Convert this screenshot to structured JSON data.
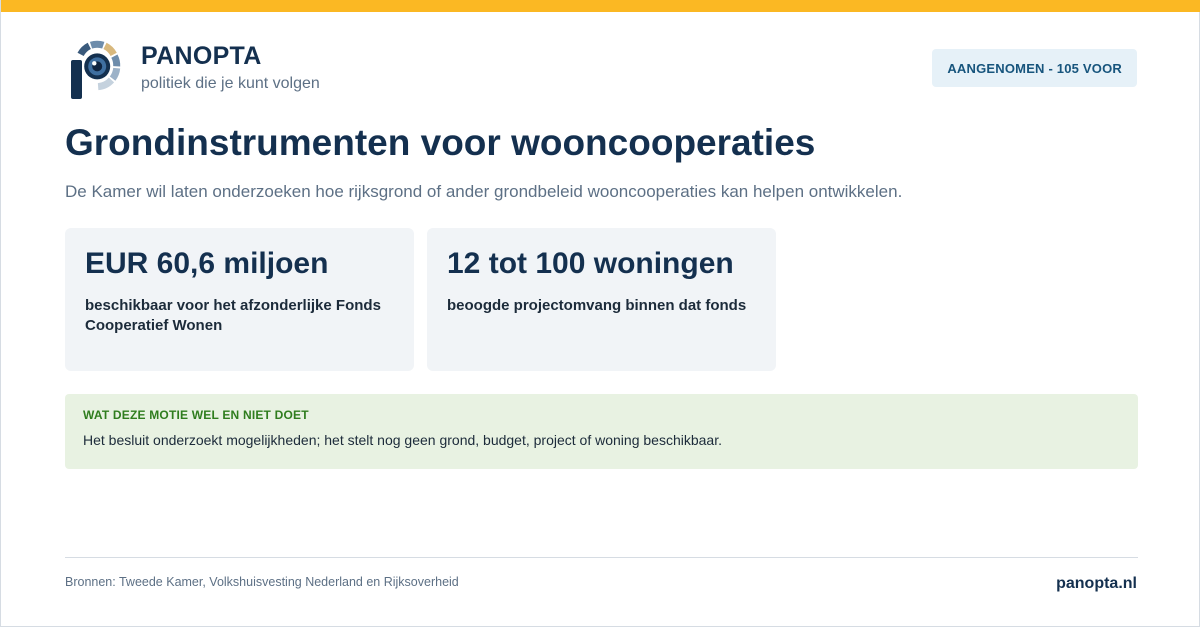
{
  "brand": {
    "name": "PANOPTA",
    "tagline": "politiek die je kunt volgen",
    "logo_icon": "panopta-eye-logo-icon"
  },
  "status_badge": "AANGENOMEN - 105 VOOR",
  "title": "Grondinstrumenten voor wooncooperaties",
  "subtitle": "De Kamer wil laten onderzoeken hoe rijksgrond of ander grondbeleid wooncooperaties kan helpen ontwikkelen.",
  "stats": [
    {
      "value": "EUR 60,6 miljoen",
      "description": "beschikbaar voor het afzonderlijke Fonds Cooperatief Wonen"
    },
    {
      "value": "12 tot 100 woningen",
      "description": "beoogde projectomvang binnen dat fonds"
    }
  ],
  "note": {
    "heading": "WAT DEZE MOTIE WEL EN NIET DOET",
    "text": "Het besluit onderzoekt mogelijkheden; het stelt nog geen grond, budget, project of woning beschikbaar."
  },
  "footer": {
    "sources": "Bronnen: Tweede Kamer, Volkshuisvesting Nederland en Rijksoverheid",
    "url": "panopta.nl"
  },
  "colors": {
    "accent_bar": "#fbb823",
    "navy": "#14304f",
    "badge_bg": "#e6f1f8",
    "note_bg": "#e8f2e2",
    "note_heading": "#2f7d1e"
  }
}
